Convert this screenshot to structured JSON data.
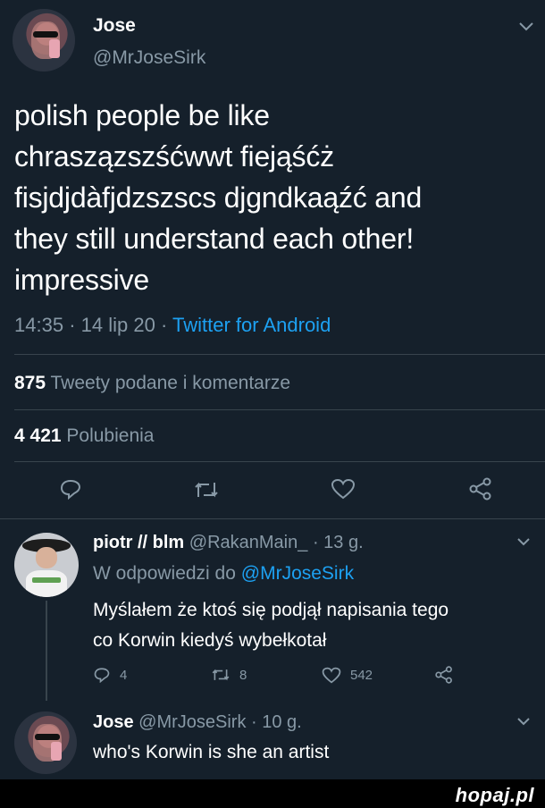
{
  "tweet": {
    "name": "Jose",
    "handle": "@MrJoseSirk",
    "text_lines": [
      "polish people be like",
      "chraszązszśćwwt fiejąśćż",
      "fisjdjdàfjdzszscs djgndkaąźć and",
      "they still understand each other!",
      "impressive"
    ],
    "time": "14:35",
    "sep1": "·",
    "date": "14 lip 20",
    "sep2": "·",
    "source": "Twitter for Android",
    "retweets_count": "875",
    "retweets_label": "Tweety podane i komentarze",
    "likes_count": "4 421",
    "likes_label": "Polubienia"
  },
  "reply1": {
    "name": "piotr // blm",
    "handle": "@RakanMain_",
    "time": "· 13 g.",
    "replying_label": "W odpowiedzi do",
    "replying_to": "@MrJoseSirk",
    "text_lines": [
      "Myślałem że ktoś się podjął napisania tego",
      "co Korwin kiedyś wybełkotał"
    ],
    "replies": "4",
    "retweets": "8",
    "likes": "542"
  },
  "reply2": {
    "name": "Jose",
    "handle": "@MrJoseSirk",
    "time": "· 10 g.",
    "text": "who's Korwin is she an artist"
  },
  "watermark": "hopaj.pl",
  "colors": {
    "background": "#15202b",
    "muted": "#8899a6",
    "link": "#1da1f2",
    "divider": "#38444d"
  },
  "icons": [
    "chevron-down-icon",
    "reply-icon",
    "retweet-icon",
    "heart-icon",
    "share-icon"
  ]
}
